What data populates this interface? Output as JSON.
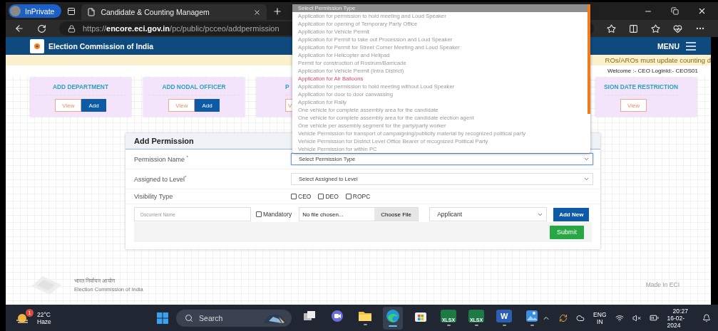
{
  "browser": {
    "profile": "InPrivate",
    "tab_title": "Candidate & Counting Managem",
    "url": "https://**encore.eci.gov.in**/pc/public/pcceo/addpermission"
  },
  "header": {
    "title": "Election Commission of India",
    "menu": "MENU"
  },
  "notice": "ROs/AROs must update counting d",
  "welcome": "Welcome :- CEO LoginId:- CEOS01",
  "cards": [
    {
      "kind": "full",
      "title": "ADD DEPARTMENT",
      "buttons": [
        {
          "label": "View",
          "kind": "outline"
        },
        {
          "label": "Add",
          "kind": "filled"
        }
      ]
    },
    {
      "kind": "full",
      "title": "ADD NODAL OFFICER",
      "buttons": [
        {
          "label": "View",
          "kind": "outline"
        },
        {
          "label": "Add",
          "kind": "filled"
        }
      ]
    },
    {
      "kind": "cut_right",
      "title": "P",
      "buttons": [
        {
          "label": "V",
          "kind": "outline"
        }
      ]
    },
    {
      "kind": "cut_left",
      "title": "SION DATE RESTRICTION",
      "buttons": [
        {
          "label": "View",
          "kind": "outline"
        }
      ]
    }
  ],
  "form": {
    "title": "Add Permission",
    "selects": [
      {
        "label": "Permission Name $^{*}$",
        "value": "Select Permission Type",
        "focused": true
      },
      {
        "label": "Assigned to Level$^{*}$",
        "value": "Select Assigned to Level",
        "focused": false
      }
    ],
    "visibility": {
      "label": "Visibility Type",
      "options": [
        {
          "label": "CEO",
          "checked": false
        },
        {
          "label": "DEO",
          "checked": false
        },
        {
          "label": "ROPC",
          "checked": false
        }
      ]
    },
    "document": {
      "placeholder": "Document Name",
      "mandatory": {
        "label": "Mandatory",
        "checked": false
      },
      "file_status": "No file chosen...",
      "file_button": "Choose File",
      "applicant": "Applicant",
      "add_button": "Add New"
    },
    "submit": "Submit"
  },
  "dropdown": {
    "placeholder_option": "Select Permission Type",
    "options": [
      {
        "label": "Application for permission to hold meeting and Loud Speaker",
        "selected": false
      },
      {
        "label": "Application for opening of Temporary Party Office",
        "selected": false
      },
      {
        "label": "Application for Vehicle Permit",
        "selected": false
      },
      {
        "label": "Application for Permit to take out Procession and Loud Speaker",
        "selected": false
      },
      {
        "label": "Application for Permit for Street Corner Meeting and Loud Speaker",
        "selected": false
      },
      {
        "label": "Application for Helicopter and Helipad",
        "selected": false
      },
      {
        "label": "Permit for construction of Rostrum/Barricade",
        "selected": false
      },
      {
        "label": "Application for Vehicle Permit (Intra District)",
        "selected": false
      },
      {
        "label": "Application for Air Balloons",
        "selected": true
      },
      {
        "label": "Application for permission to hold meeting without Loud Speaker",
        "selected": false
      },
      {
        "label": "Application for door to door canvassing",
        "selected": false
      },
      {
        "label": "Application for Rally",
        "selected": false
      },
      {
        "label": "One vehicle for complete assembly area for the candidate",
        "selected": false
      },
      {
        "label": "One vehicle for complete assembly area for the candidate election agent",
        "selected": false
      },
      {
        "label": "One vehicle per assembly segment for the party/party worker",
        "selected": false
      },
      {
        "label": "Vehicle Permission for transport of campaigning/publicity material by recognized political party",
        "selected": false
      },
      {
        "label": "Vehicle Permission for District Level Office Bearer of recognized Political Party",
        "selected": false
      },
      {
        "label": "Vehicle Permission for within PC",
        "selected": false
      }
    ]
  },
  "footer": {
    "hindi": "भारत निर्वाचन आयोग",
    "english": "Election Commission of India",
    "made_in": "Made In ECI"
  },
  "taskbar": {
    "weather_badge": "1",
    "temperature": "22°C",
    "condition": "Haze",
    "search": "Search",
    "apps": [
      {
        "kind": "task_view",
        "running": false,
        "selected": false
      },
      {
        "kind": "chat",
        "running": false,
        "selected": false
      },
      {
        "kind": "folder",
        "running": true,
        "selected": false
      },
      {
        "kind": "edge",
        "running": true,
        "selected": true
      },
      {
        "kind": "store",
        "running": false,
        "selected": false
      },
      {
        "kind": "sheet",
        "label": "XLSX",
        "running": true,
        "selected": false
      },
      {
        "kind": "sheet",
        "label": "XLSX",
        "running": true,
        "selected": false
      },
      {
        "kind": "word",
        "label": "W",
        "running": true,
        "selected": false
      },
      {
        "kind": "photos",
        "running": true,
        "selected": false
      }
    ],
    "language": "ENG",
    "region": "IN",
    "time": "20:27",
    "date": "16-02-2024"
  }
}
